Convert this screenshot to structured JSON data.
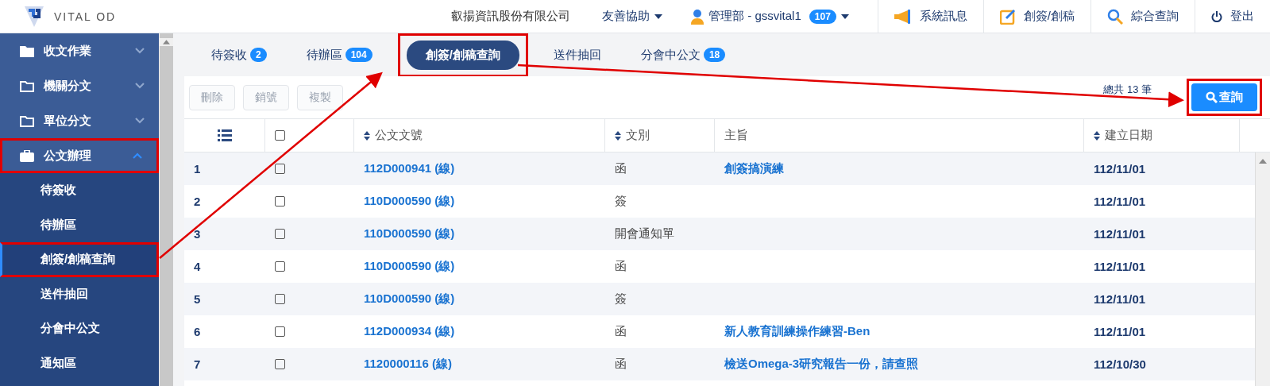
{
  "header": {
    "logo": "VITAL OD",
    "company": "叡揚資訊股份有限公司",
    "menus": [
      {
        "kind": "dropdown",
        "label": "友善協助"
      },
      {
        "kind": "user",
        "label": "管理部 - gssvital1",
        "badge": "107"
      }
    ],
    "actions": [
      {
        "kind": "megaphone",
        "label": "系統訊息"
      },
      {
        "kind": "edit",
        "label": "創簽/創稿"
      },
      {
        "kind": "search",
        "label": "綜合查詢"
      },
      {
        "kind": "power",
        "label": "登出"
      }
    ]
  },
  "sidebar": {
    "items": [
      {
        "kind": "folder",
        "label": "收文作業",
        "expanded": false,
        "highlighted": false
      },
      {
        "kind": "folder-outline",
        "label": "機關分文",
        "expanded": false,
        "highlighted": false
      },
      {
        "kind": "folder-outline",
        "label": "單位分文",
        "expanded": false,
        "highlighted": false
      },
      {
        "kind": "briefcase",
        "label": "公文辦理",
        "expanded": true,
        "highlighted": true,
        "children": [
          {
            "label": "待簽收",
            "selected": false,
            "highlighted": false
          },
          {
            "label": "待辦區",
            "selected": false,
            "highlighted": false
          },
          {
            "label": "創簽/創稿查詢",
            "selected": true,
            "highlighted": true
          },
          {
            "label": "送件抽回",
            "selected": false,
            "highlighted": false
          },
          {
            "label": "分會中公文",
            "selected": false,
            "highlighted": false
          },
          {
            "label": "通知區",
            "selected": false,
            "highlighted": false
          }
        ]
      }
    ]
  },
  "tabs": [
    {
      "label": "待簽收",
      "badge": "2",
      "selected": false,
      "highlighted": false
    },
    {
      "label": "待辦區",
      "badge": "104",
      "selected": false,
      "highlighted": false
    },
    {
      "label": "創簽/創稿查詢",
      "selected": true,
      "highlighted": true
    },
    {
      "label": "送件抽回",
      "selected": false,
      "highlighted": false
    },
    {
      "label": "分會中公文",
      "badge": "18",
      "selected": false,
      "highlighted": false
    }
  ],
  "toolbar": {
    "buttons": [
      {
        "label": "刪除",
        "disabled": true
      },
      {
        "label": "銷號",
        "disabled": true
      },
      {
        "label": "複製",
        "disabled": true
      }
    ],
    "total": "總共 13 筆",
    "query_button": {
      "label": "查詢",
      "highlighted": true
    }
  },
  "table": {
    "columns": [
      {
        "kind": "index"
      },
      {
        "kind": "checkbox",
        "checked": false
      },
      {
        "kind": "sortable",
        "label": "公文文號"
      },
      {
        "kind": "sortable",
        "label": "文別"
      },
      {
        "kind": "plain",
        "label": "主旨"
      },
      {
        "kind": "sortable",
        "label": "建立日期"
      }
    ],
    "rows": [
      {
        "no": "1",
        "checked": false,
        "doc_no": "112D000941 (線)",
        "type": "函",
        "subject": "創簽搞演練",
        "date": "112/11/01"
      },
      {
        "no": "2",
        "checked": false,
        "doc_no": "110D000590 (線)",
        "type": "簽",
        "date": "112/11/01"
      },
      {
        "no": "3",
        "checked": false,
        "doc_no": "110D000590 (線)",
        "type": "開會通知單",
        "date": "112/11/01"
      },
      {
        "no": "4",
        "checked": false,
        "doc_no": "110D000590 (線)",
        "type": "函",
        "date": "112/11/01"
      },
      {
        "no": "5",
        "checked": false,
        "doc_no": "110D000590 (線)",
        "type": "簽",
        "date": "112/11/01"
      },
      {
        "no": "6",
        "checked": false,
        "doc_no": "112D000934 (線)",
        "type": "函",
        "subject": "新人教育訓練操作練習-Ben",
        "date": "112/11/01"
      },
      {
        "no": "7",
        "checked": false,
        "doc_no": "1120000116 (線)",
        "type": "函",
        "subject": "檢送Omega-3研究報告一份，請查照",
        "date": "112/10/30"
      }
    ]
  }
}
